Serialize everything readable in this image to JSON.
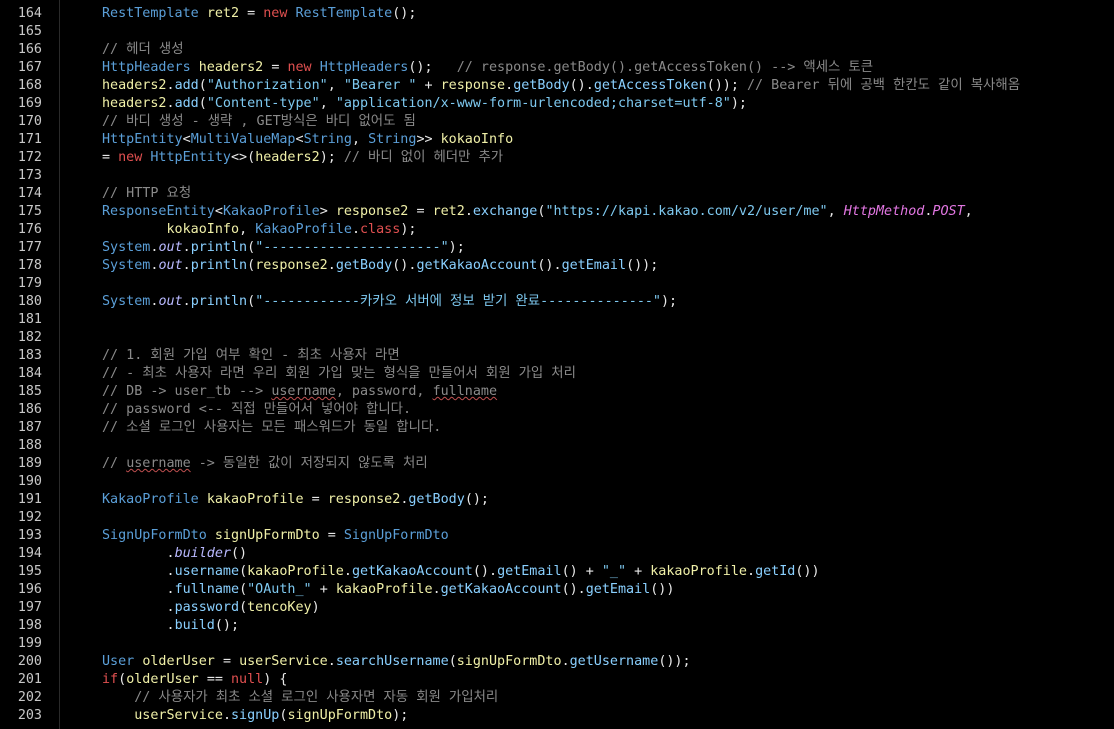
{
  "editor": {
    "lines": [
      {
        "n": "",
        "code": ""
      },
      {
        "n": "164",
        "code": "RestTemplate ret2 = new RestTemplate();"
      },
      {
        "n": "165",
        "code": ""
      },
      {
        "n": "166",
        "code": "// 헤더 생성"
      },
      {
        "n": "167",
        "code": "HttpHeaders headers2 = new HttpHeaders();   // response.getBody().getAccessToken() --> 액세스 토큰"
      },
      {
        "n": "168",
        "code": "headers2.add(\"Authorization\", \"Bearer \" + response.getBody().getAccessToken()); // Bearer 뒤에 공백 한칸도 같이 복사해옴"
      },
      {
        "n": "169",
        "code": "headers2.add(\"Content-type\", \"application/x-www-form-urlencoded;charset=utf-8\");"
      },
      {
        "n": "170",
        "code": "// 바디 생성 - 생략 , GET방식은 바디 없어도 됨"
      },
      {
        "n": "171",
        "code": "HttpEntity<MultiValueMap<String, String>> kokaoInfo"
      },
      {
        "n": "172",
        "code": "= new HttpEntity<>(headers2); // 바디 없이 헤더만 추가"
      },
      {
        "n": "173",
        "code": ""
      },
      {
        "n": "174",
        "code": "// HTTP 요청"
      },
      {
        "n": "175",
        "code": "ResponseEntity<KakaoProfile> response2 = ret2.exchange(\"https://kapi.kakao.com/v2/user/me\", HttpMethod.POST,"
      },
      {
        "n": "176",
        "code": "        kokaoInfo, KakaoProfile.class);"
      },
      {
        "n": "177",
        "code": "System.out.println(\"----------------------\");"
      },
      {
        "n": "178",
        "code": "System.out.println(response2.getBody().getKakaoAccount().getEmail());"
      },
      {
        "n": "179",
        "code": ""
      },
      {
        "n": "180",
        "code": "System.out.println(\"------------카카오 서버에 정보 받기 완료--------------\");"
      },
      {
        "n": "181",
        "code": ""
      },
      {
        "n": "182",
        "code": ""
      },
      {
        "n": "183",
        "code": "// 1. 회원 가입 여부 확인 - 최초 사용자 라면"
      },
      {
        "n": "184",
        "code": "// - 최초 사용자 라면 우리 회원 가입 맞는 형식을 만들어서 회원 가입 처리"
      },
      {
        "n": "185",
        "code": "// DB -> user_tb --> username, password, fullname"
      },
      {
        "n": "186",
        "code": "// password <-- 직접 만들어서 넣어야 합니다."
      },
      {
        "n": "187",
        "code": "// 소셜 로그인 사용자는 모든 패스워드가 동일 합니다."
      },
      {
        "n": "188",
        "code": ""
      },
      {
        "n": "189",
        "code": "// username -> 동일한 값이 저장되지 않도록 처리"
      },
      {
        "n": "190",
        "code": ""
      },
      {
        "n": "191",
        "code": "KakaoProfile kakaoProfile = response2.getBody();"
      },
      {
        "n": "192",
        "code": ""
      },
      {
        "n": "193",
        "code": "SignUpFormDto signUpFormDto = SignUpFormDto"
      },
      {
        "n": "194",
        "code": "        .builder()"
      },
      {
        "n": "195",
        "code": "        .username(kakaoProfile.getKakaoAccount().getEmail() + \"_\" + kakaoProfile.getId())"
      },
      {
        "n": "196",
        "code": "        .fullname(\"OAuth_\" + kakaoProfile.getKakaoAccount().getEmail())"
      },
      {
        "n": "197",
        "code": "        .password(tencoKey)"
      },
      {
        "n": "198",
        "code": "        .build();"
      },
      {
        "n": "199",
        "code": ""
      },
      {
        "n": "200",
        "code": "User olderUser = userService.searchUsername(signUpFormDto.getUsername());"
      },
      {
        "n": "201",
        "code": "if(olderUser == null) {"
      },
      {
        "n": "202",
        "code": "    // 사용자가 최초 소셜 로그인 사용자면 자동 회원 가입처리"
      },
      {
        "n": "203",
        "code": "    userService.signUp(signUpFormDto);"
      }
    ]
  }
}
